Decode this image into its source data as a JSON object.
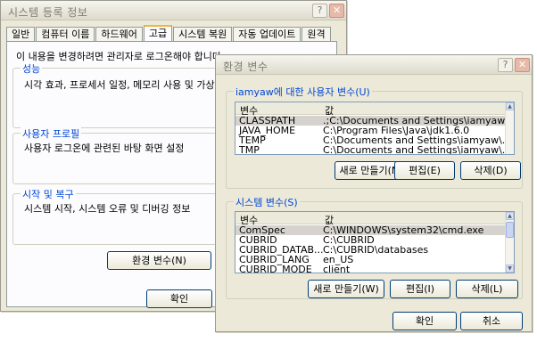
{
  "sysprops": {
    "title": "시스템 등록 정보",
    "help_button": "?",
    "close_button": "✕",
    "tabs": [
      {
        "label": "일반"
      },
      {
        "label": "컴퓨터 이름"
      },
      {
        "label": "하드웨어"
      },
      {
        "label": "고급"
      },
      {
        "label": "시스템 복원"
      },
      {
        "label": "자동 업데이트"
      },
      {
        "label": "원격"
      }
    ],
    "intro": "이 내용을 변경하려면 관리자로 로그온해야 합니다",
    "performance": {
      "title": "성능",
      "text": "시각 효과, 프로세서 일정, 메모리 사용 및 가상 메"
    },
    "profiles": {
      "title": "사용자 프로필",
      "text": "사용자 로그온에 관련된 바탕 화면 설정"
    },
    "startup": {
      "title": "시작 및 복구",
      "text": "시스템 시작, 시스템 오류 및 디버깅 정보"
    },
    "env_button": "환경 변수(N)",
    "ok_button": "확인"
  },
  "envdialog": {
    "title": "환경 변수",
    "help_button": "?",
    "close_button": "✕",
    "user_vars": {
      "title": "iamyaw에 대한 사용자 변수(U)",
      "col_var": "변수",
      "col_val": "값",
      "rows": [
        {
          "name": "CLASSPATH",
          "value": ".;C:\\Documents and Settings\\iamyaw..."
        },
        {
          "name": "JAVA_HOME",
          "value": "C:\\Program Files\\Java\\jdk1.6.0"
        },
        {
          "name": "TEMP",
          "value": "C:\\Documents and Settings\\iamyaw\\..."
        },
        {
          "name": "TMP",
          "value": "C:\\Documents and Settings\\iamyaw\\..."
        }
      ],
      "new_button": "새로 만들기(N)",
      "edit_button": "편집(E)",
      "delete_button": "삭제(D)"
    },
    "sys_vars": {
      "title": "시스템 변수(S)",
      "col_var": "변수",
      "col_val": "값",
      "rows": [
        {
          "name": "ComSpec",
          "value": "C:\\WINDOWS\\system32\\cmd.exe"
        },
        {
          "name": "CUBRID",
          "value": "C:\\CUBRID"
        },
        {
          "name": "CUBRID_DATAB...",
          "value": "C:\\CUBRID\\databases"
        },
        {
          "name": "CUBRID_LANG",
          "value": "en_US"
        },
        {
          "name": "CUBRID_MODE",
          "value": "client"
        }
      ],
      "new_button": "새로 만들기(W)",
      "edit_button": "편집(I)",
      "delete_button": "삭제(L)"
    },
    "ok_button": "확인",
    "cancel_button": "취소"
  }
}
